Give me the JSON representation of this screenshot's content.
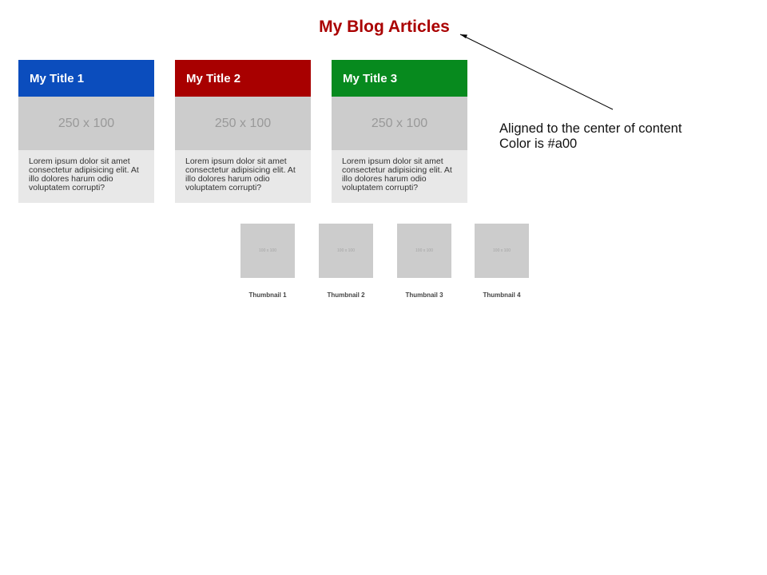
{
  "page": {
    "title": "My Blog Articles",
    "title_color": "#aa0000"
  },
  "cards": [
    {
      "title": "My Title 1",
      "header_color": "#0b4dbd",
      "image_placeholder": "250 x 100",
      "body": "Lorem ipsum dolor sit amet consectetur adipisicing elit. At illo dolores harum odio voluptatem corrupti?"
    },
    {
      "title": "My Title 2",
      "header_color": "#a80000",
      "image_placeholder": "250 x 100",
      "body": "Lorem ipsum dolor sit amet consectetur adipisicing elit. At illo dolores harum odio voluptatem corrupti?"
    },
    {
      "title": "My Title 3",
      "header_color": "#078a1e",
      "image_placeholder": "250 x 100",
      "body": "Lorem ipsum dolor sit amet consectetur adipisicing elit. At illo dolores harum odio voluptatem corrupti?"
    }
  ],
  "thumbnails": [
    {
      "placeholder": "100 x 100",
      "label": "Thumbnail 1"
    },
    {
      "placeholder": "100 x 100",
      "label": "Thumbnail 2"
    },
    {
      "placeholder": "100 x 100",
      "label": "Thumbnail 3"
    },
    {
      "placeholder": "100 x 100",
      "label": "Thumbnail 4"
    }
  ],
  "annotation": {
    "line1": "Aligned to the center of content",
    "line2": "Color is #a00",
    "icon": "arrow-icon"
  }
}
